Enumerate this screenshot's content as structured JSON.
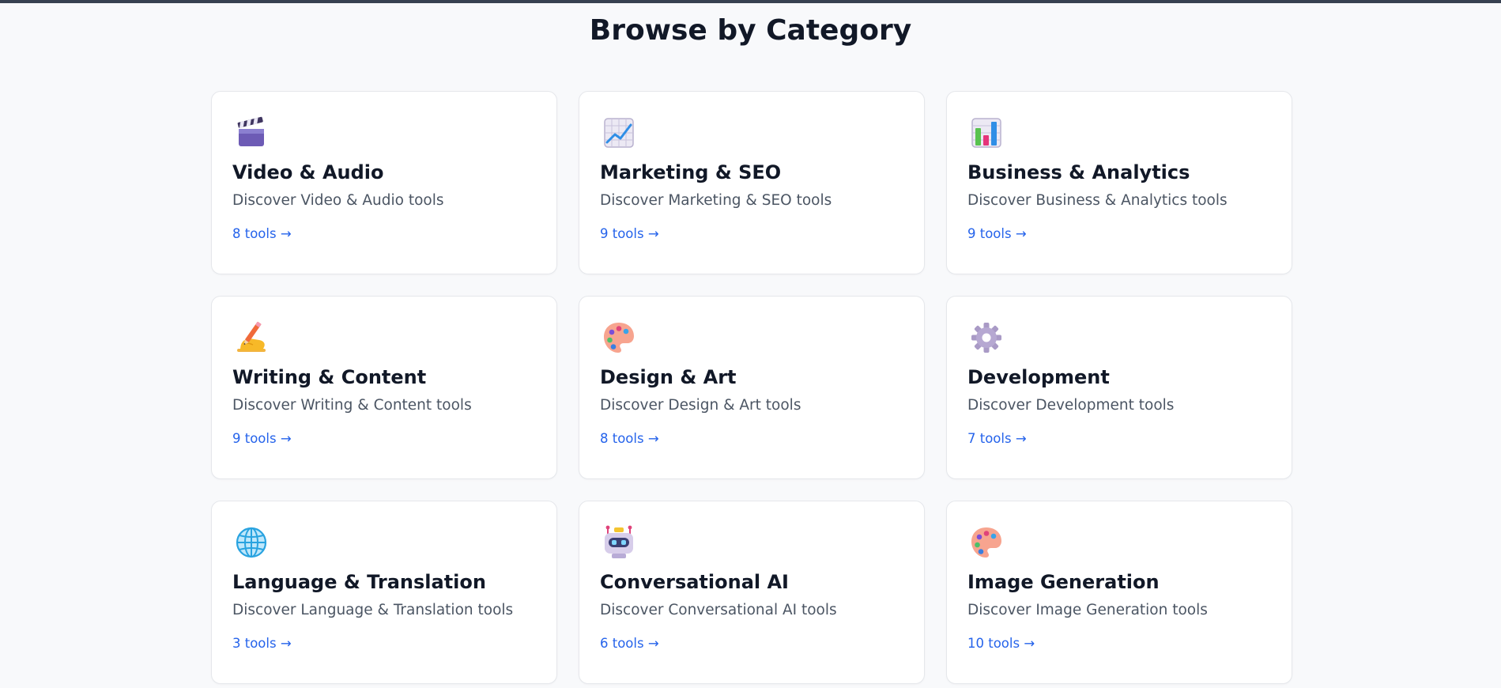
{
  "page": {
    "title": "Browse by Category"
  },
  "categories": [
    {
      "title": "Video & Audio",
      "description": "Discover Video & Audio tools",
      "count_label": "8 tools →",
      "icon": "clapper-board-icon"
    },
    {
      "title": "Marketing & SEO",
      "description": "Discover Marketing & SEO tools",
      "count_label": "9 tools →",
      "icon": "chart-increasing-icon"
    },
    {
      "title": "Business & Analytics",
      "description": "Discover Business & Analytics tools",
      "count_label": "9 tools →",
      "icon": "bar-chart-icon"
    },
    {
      "title": "Writing & Content",
      "description": "Discover Writing & Content tools",
      "count_label": "9 tools →",
      "icon": "writing-hand-icon"
    },
    {
      "title": "Design & Art",
      "description": "Discover Design & Art tools",
      "count_label": "8 tools →",
      "icon": "artist-palette-icon"
    },
    {
      "title": "Development",
      "description": "Discover Development tools",
      "count_label": "7 tools →",
      "icon": "gear-icon"
    },
    {
      "title": "Language & Translation",
      "description": "Discover Language & Translation tools",
      "count_label": "3 tools →",
      "icon": "globe-icon"
    },
    {
      "title": "Conversational AI",
      "description": "Discover Conversational AI tools",
      "count_label": "6 tools →",
      "icon": "robot-icon"
    },
    {
      "title": "Image Generation",
      "description": "Discover Image Generation tools",
      "count_label": "10 tools →",
      "icon": "artist-palette-icon"
    }
  ],
  "colors": {
    "background": "#f8f9fb",
    "card_border": "#e5e7eb",
    "title": "#111827",
    "description": "#4b5563",
    "link": "#2563eb"
  }
}
